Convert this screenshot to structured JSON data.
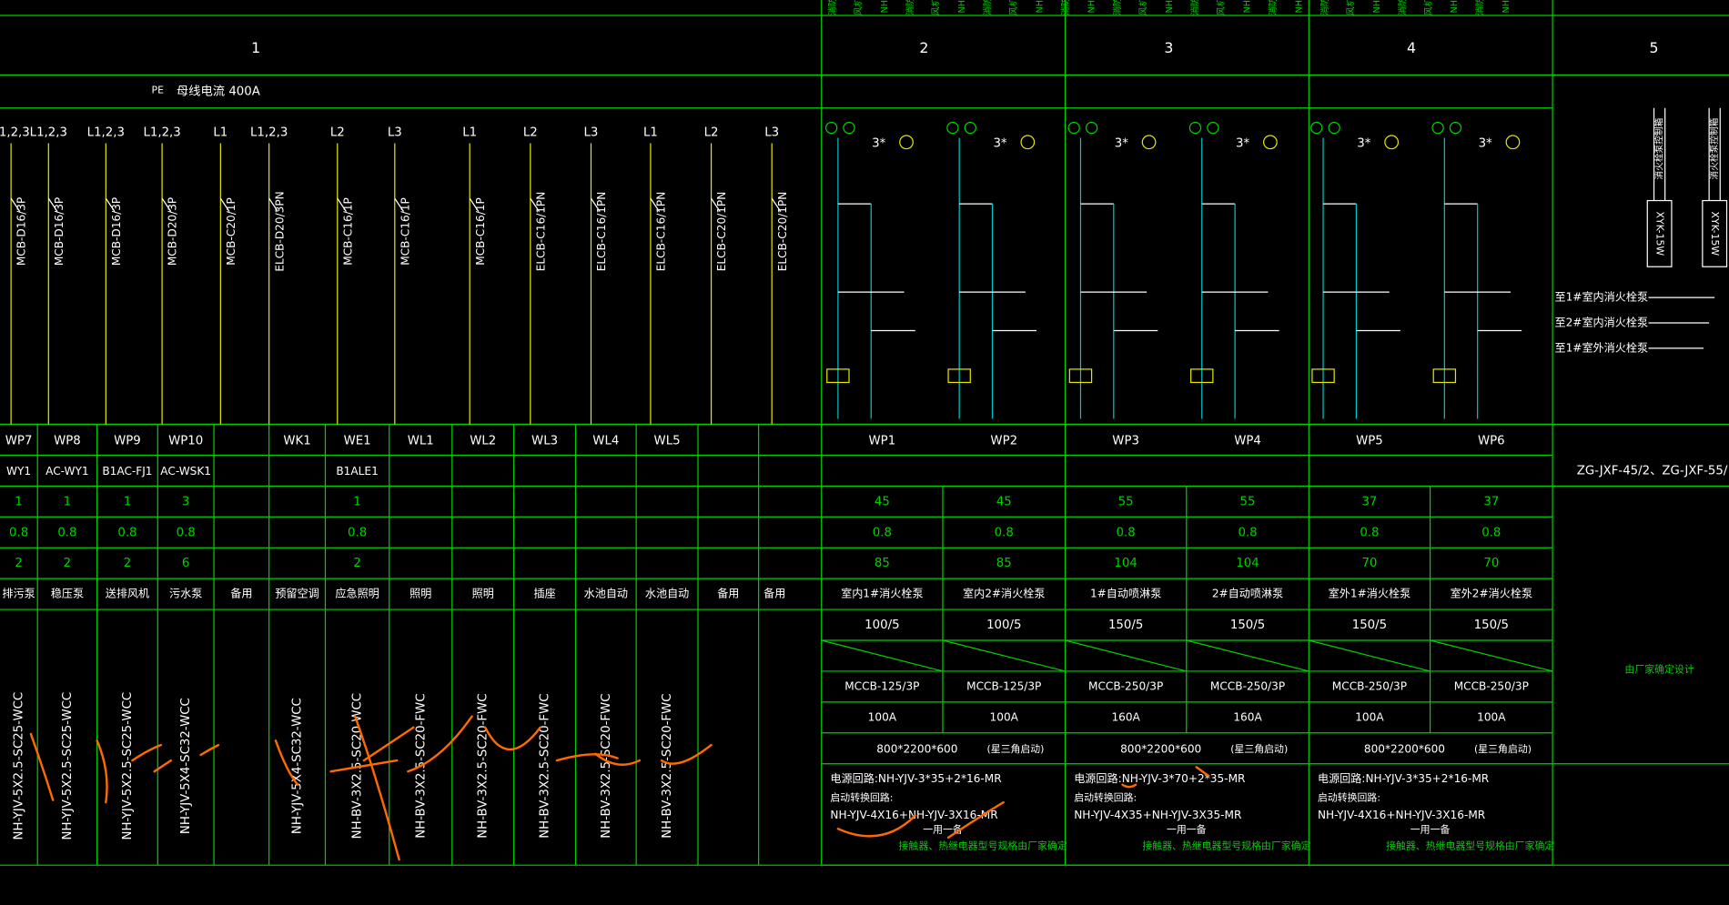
{
  "sections": [
    "1",
    "2",
    "3",
    "4",
    "5"
  ],
  "top_labels": [
    "消防",
    "风机",
    "NH",
    "消防",
    "风机",
    "NH",
    "消防",
    "风机",
    "NH",
    "消防",
    "NH",
    "消防",
    "风机",
    "NH",
    "消防",
    "风机",
    "NH",
    "消防",
    "NH",
    "消防",
    "风机",
    "NH",
    "消防",
    "风机",
    "NH",
    "消防",
    "NH"
  ],
  "busbar": {
    "pe": "PE",
    "label": "母线电流 400A"
  },
  "left_circuits": [
    {
      "phase": "L1,2,3",
      "breaker": "MCB-D16/3P",
      "code": "WP7",
      "device": "WY1",
      "qty": "1",
      "kx": "0.8",
      "power": "2",
      "use": "排污泵",
      "cable": "NH-YJV-5X2.5-SC25-WCC"
    },
    {
      "phase": "L1,2,3",
      "breaker": "MCB-D16/3P",
      "code": "WP8",
      "device": "AC-WY1",
      "qty": "1",
      "kx": "0.8",
      "power": "2",
      "use": "稳压泵",
      "cable": "NH-YJV-5X2.5-SC25-WCC"
    },
    {
      "phase": "L1,2,3",
      "breaker": "MCB-D16/3P",
      "code": "WP9",
      "device": "B1AC-FJ1",
      "qty": "1",
      "kx": "0.8",
      "power": "2",
      "use": "送排风机",
      "cable": "NH-YJV-5X2.5-SC25-WCC"
    },
    {
      "phase": "L1,2,3",
      "breaker": "MCB-D20/3P",
      "code": "WP10",
      "device": "AC-WSK1",
      "qty": "3",
      "kx": "0.8",
      "power": "6",
      "use": "污水泵",
      "cable": "NH-YJV-5X4-SC32-WCC"
    },
    {
      "phase": "L1",
      "breaker": "MCB-C20/1P",
      "code": "",
      "device": "",
      "qty": "",
      "kx": "",
      "power": "",
      "use": "备用",
      "cable": ""
    },
    {
      "phase": "L1,2,3",
      "breaker": "ELCB-D20/3PN",
      "code": "WK1",
      "device": "",
      "qty": "",
      "kx": "",
      "power": "",
      "use": "预留空调",
      "cable": "NH-YJV-5X4-SC32-WCC"
    },
    {
      "phase": "L2",
      "breaker": "MCB-C16/1P",
      "code": "WE1",
      "device": "B1ALE1",
      "qty": "1",
      "kx": "0.8",
      "power": "2",
      "use": "应急照明",
      "cable": "NH-BV-3X2.5-SC20-WCC"
    },
    {
      "phase": "L3",
      "breaker": "MCB-C16/1P",
      "code": "WL1",
      "device": "",
      "qty": "",
      "kx": "",
      "power": "",
      "use": "照明",
      "cable": "NH-BV-3X2.5-SC20-FWC"
    },
    {
      "phase": "L1",
      "breaker": "MCB-C16/1P",
      "code": "WL2",
      "device": "",
      "qty": "",
      "kx": "",
      "power": "",
      "use": "照明",
      "cable": "NH-BV-3X2.5-SC20-FWC"
    },
    {
      "phase": "L2",
      "breaker": "ELCB-C16/1PN",
      "code": "WL3",
      "device": "",
      "qty": "",
      "kx": "",
      "power": "",
      "use": "插座",
      "cable": "NH-BV-3X2.5-SC20-FWC"
    },
    {
      "phase": "L3",
      "breaker": "ELCB-C16/1PN",
      "code": "WL4",
      "device": "",
      "qty": "",
      "kx": "",
      "power": "",
      "use": "水池自动",
      "cable": "NH-BV-3X2.5-SC20-FWC"
    },
    {
      "phase": "L1",
      "breaker": "ELCB-C16/1PN",
      "code": "WL5",
      "device": "",
      "qty": "",
      "kx": "",
      "power": "",
      "use": "水池自动",
      "cable": "NH-BV-3X2.5-SC20-FWC"
    },
    {
      "phase": "L2",
      "breaker": "ELCB-C20/1PN",
      "code": "",
      "device": "",
      "qty": "",
      "kx": "",
      "power": "",
      "use": "备用",
      "cable": ""
    },
    {
      "phase": "L3",
      "breaker": "ELCB-C20/1PN",
      "code": "",
      "device": "",
      "qty": "",
      "kx": "",
      "power": "",
      "use": "备用",
      "cable": ""
    }
  ],
  "pump_labels": [
    "3*",
    "3*",
    "3*",
    "3*",
    "3*",
    "3*"
  ],
  "right_circuits": [
    {
      "code": "WP1",
      "power": "45",
      "kx": "0.8",
      "current": "85",
      "use": "室内1#消火栓泵",
      "ct": "100/5",
      "breaker": "MCCB-125/3P",
      "trip": "100A"
    },
    {
      "code": "WP2",
      "power": "45",
      "kx": "0.8",
      "current": "85",
      "use": "室内2#消火栓泵",
      "ct": "100/5",
      "breaker": "MCCB-125/3P",
      "trip": "100A"
    },
    {
      "code": "WP3",
      "power": "55",
      "kx": "0.8",
      "current": "104",
      "use": "1#自动喷淋泵",
      "ct": "150/5",
      "breaker": "MCCB-250/3P",
      "trip": "160A"
    },
    {
      "code": "WP4",
      "power": "55",
      "kx": "0.8",
      "current": "104",
      "use": "2#自动喷淋泵",
      "ct": "150/5",
      "breaker": "MCCB-250/3P",
      "trip": "160A"
    },
    {
      "code": "WP5",
      "power": "37",
      "kx": "0.8",
      "current": "70",
      "use": "室外1#消火栓泵",
      "ct": "150/5",
      "breaker": "MCCB-250/3P",
      "trip": "100A"
    },
    {
      "code": "WP6",
      "power": "37",
      "kx": "0.8",
      "current": "70",
      "use": "室外2#消火栓泵",
      "ct": "150/5",
      "breaker": "MCCB-250/3P",
      "trip": "100A"
    }
  ],
  "cabinets": [
    {
      "size": "800*2200*600",
      "note": "(星三角启动)",
      "main": "电源回路:NH-YJV-3*35+2*16-MR",
      "start_label": "启动转换回路:",
      "start": "NH-YJV-4X16+NH-YJV-3X16-MR",
      "duty": "一用一备",
      "remark": "接触器、热继电器型号规格由厂家确定"
    },
    {
      "size": "800*2200*600",
      "note": "(星三角启动)",
      "main": "电源回路:NH-YJV-3*70+2*35-MR",
      "start_label": "启动转换回路:",
      "start": "NH-YJV-4X35+NH-YJV-3X35-MR",
      "duty": "一用一备",
      "remark": "接触器、热继电器型号规格由厂家确定"
    },
    {
      "size": "800*2200*600",
      "note": "(星三角启动)",
      "main": "电源回路:NH-YJV-3*35+2*16-MR",
      "start_label": "启动转换回路:",
      "start": "NH-YJV-4X16+NH-YJV-3X16-MR",
      "duty": "一用一备",
      "remark": "接触器、热继电器型号规格由厂家确定"
    }
  ],
  "section5": {
    "model": "ZG-JXF-45/2、ZG-JXF-55/",
    "design_note": "由厂家确定设计",
    "feeds": [
      "至1#室内消火栓泵",
      "至2#室内消火栓泵",
      "至1#室外消火栓泵"
    ],
    "module": "XYK-15W",
    "vertical_labels": [
      "消火栓泵控制箱",
      "消火栓泵控制箱"
    ]
  },
  "colors": {
    "grid": "#00d000",
    "text": "#ffffff",
    "yellow": "#e6e600",
    "cyan": "#00c8c8",
    "markup": "#ff6a00"
  }
}
